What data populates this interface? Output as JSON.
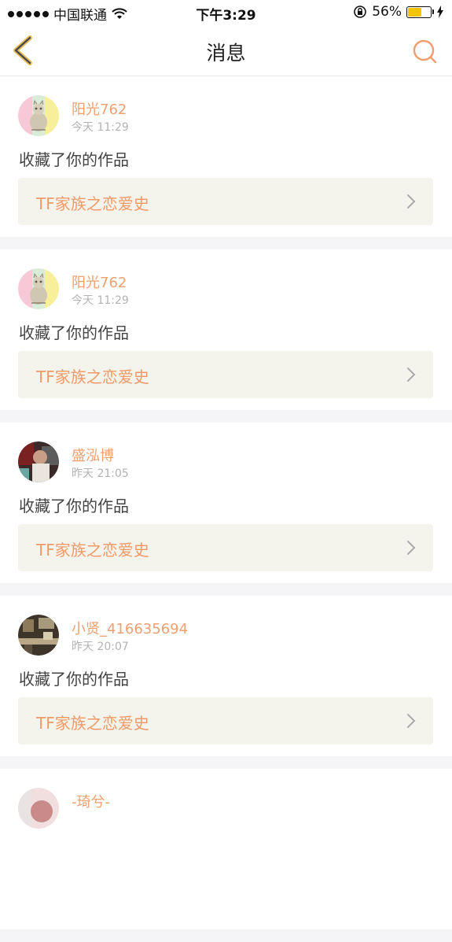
{
  "status_bar": {
    "carrier": "中国联通",
    "time": "下午3:29",
    "battery_text": "56%",
    "battery_level": 0.56,
    "icons": [
      "signal-dots-icon",
      "wifi-icon",
      "rotation-lock-icon",
      "battery-icon",
      "charging-icon"
    ]
  },
  "navbar": {
    "title": "消息",
    "back_icon": "chevron-left-icon",
    "search_icon": "search-icon",
    "accent": "#f0a070"
  },
  "messages": [
    {
      "user": "阳光762",
      "time": "今天 11:29",
      "action": "收藏了你的作品",
      "work_title": "TF家族之恋爱史",
      "avatar": "cat-avatar"
    },
    {
      "user": "阳光762",
      "time": "今天 11:29",
      "action": "收藏了你的作品",
      "work_title": "TF家族之恋爱史",
      "avatar": "cat-avatar"
    },
    {
      "user": "盛泓博",
      "time": "昨天 21:05",
      "action": "收藏了你的作品",
      "work_title": "TF家族之恋爱史",
      "avatar": "person-avatar"
    },
    {
      "user": "小贤_416635694",
      "time": "昨天 20:07",
      "action": "收藏了你的作品",
      "work_title": "TF家族之恋爱史",
      "avatar": "room-avatar"
    },
    {
      "user": "-琦兮-",
      "time": "",
      "action": "",
      "work_title": "",
      "avatar": "pink-avatar"
    }
  ],
  "colors": {
    "username": "#f0a070",
    "work_title": "#f09a68",
    "card_bg": "#f5f4ec",
    "page_bg": "#f5f4f6"
  }
}
